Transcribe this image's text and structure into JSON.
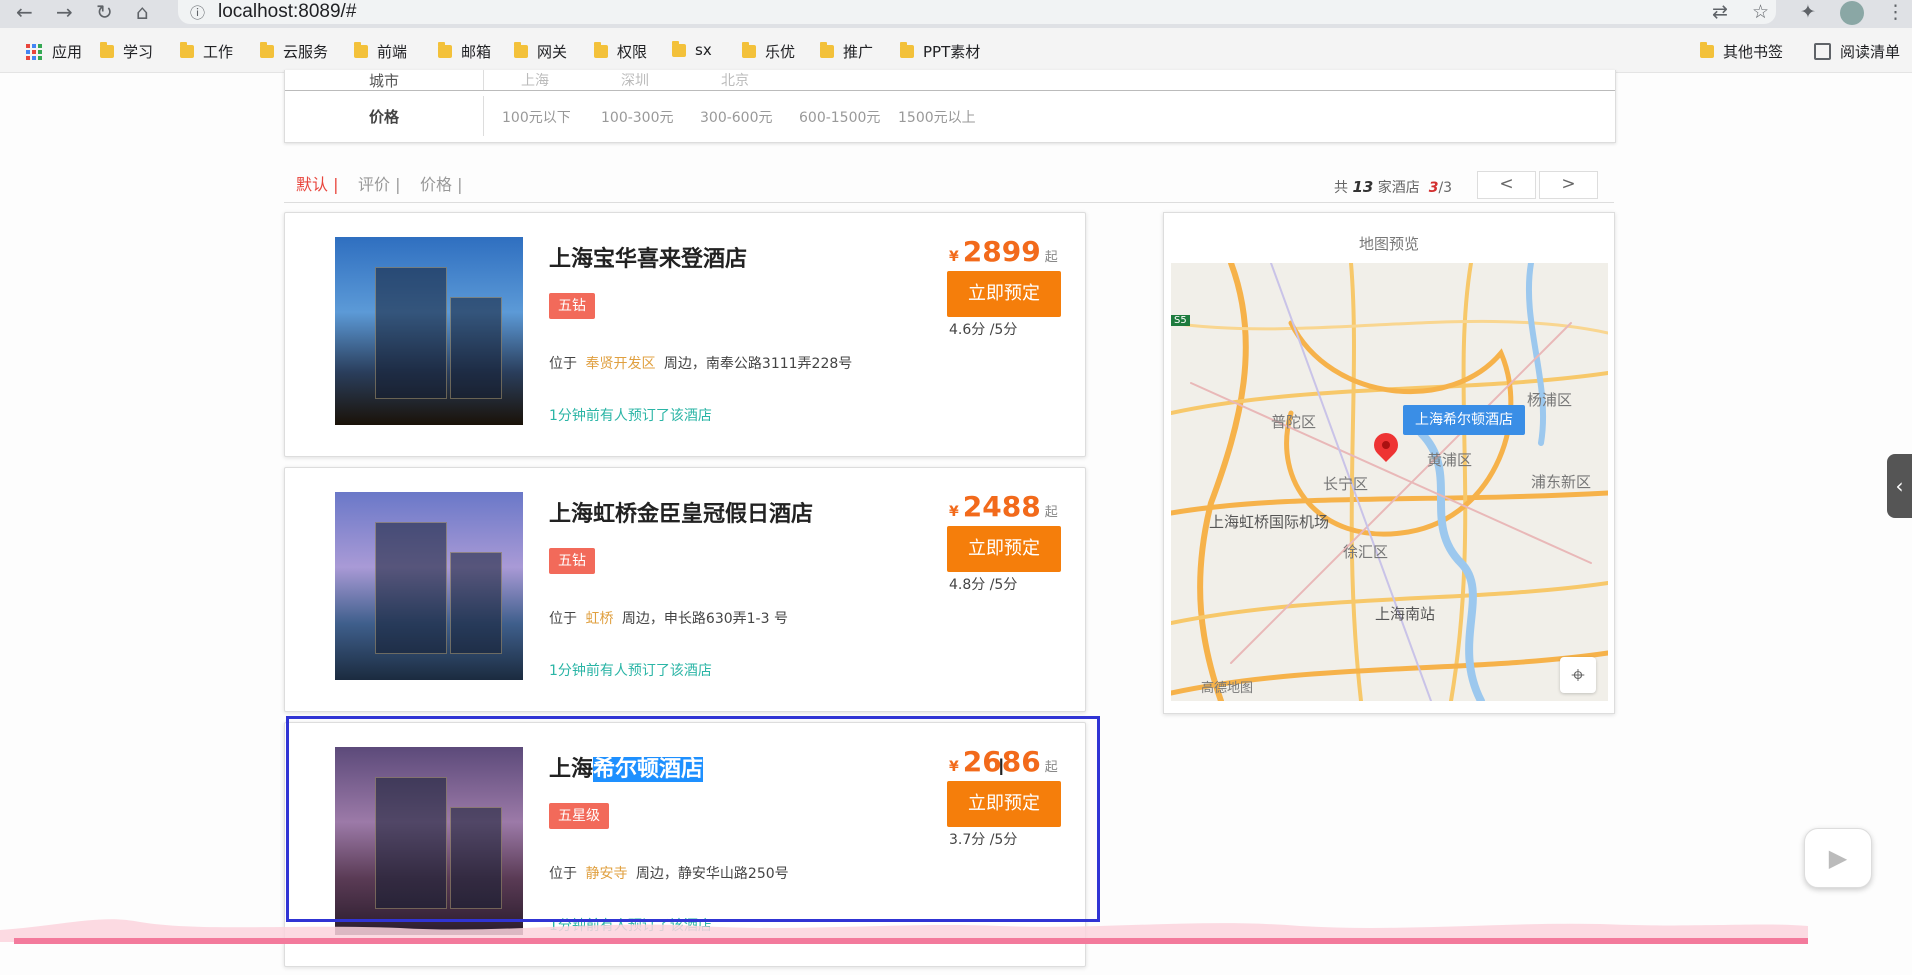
{
  "browser": {
    "url": "localhost:8089/#",
    "bookmarks": [
      {
        "label": "应用",
        "type": "apps"
      },
      {
        "label": "学习",
        "type": "folder"
      },
      {
        "label": "工作",
        "type": "folder"
      },
      {
        "label": "云服务",
        "type": "folder"
      },
      {
        "label": "前端",
        "type": "folder"
      },
      {
        "label": "邮箱",
        "type": "folder"
      },
      {
        "label": "网关",
        "type": "folder"
      },
      {
        "label": "权限",
        "type": "folder"
      },
      {
        "label": "sx",
        "type": "folder"
      },
      {
        "label": "乐优",
        "type": "folder"
      },
      {
        "label": "推广",
        "type": "folder"
      },
      {
        "label": "PPT素材",
        "type": "folder"
      }
    ],
    "other_bookmarks": "其他书签",
    "reading_list": "阅读清单"
  },
  "filter": {
    "city_label": "城市",
    "cities": [
      "上海",
      "深圳",
      "北京"
    ],
    "price_label": "价格",
    "prices": [
      "100元以下",
      "100-300元",
      "300-600元",
      "600-1500元",
      "1500元以上"
    ]
  },
  "sort": {
    "options": [
      "默认 |",
      "评价 |",
      "价格 |"
    ],
    "active_index": 0,
    "total_prefix": "共",
    "total": "13",
    "total_suffix": "家酒店",
    "page_current": "3",
    "page_total": "/3",
    "prev": "<",
    "next": ">"
  },
  "hotels": [
    {
      "name": "上海宝华喜来登酒店",
      "name_plain": "",
      "name_highlight": "",
      "tag": "五钻",
      "addr_prefix": "位于",
      "area": "奉贤开发区",
      "addr_suffix": "周边，南奉公路3111弄228号",
      "booked": "1分钟前有人预订了该酒店",
      "yen": "¥",
      "price": "2899",
      "qi": "起",
      "book": "立即预定",
      "score": "4.6分 /5分"
    },
    {
      "name": "上海虹桥金臣皇冠假日酒店",
      "name_plain": "",
      "name_highlight": "",
      "tag": "五钻",
      "addr_prefix": "位于",
      "area": "虹桥",
      "addr_suffix": "周边，申长路630弄1-3 号",
      "booked": "1分钟前有人预订了该酒店",
      "yen": "¥",
      "price": "2488",
      "qi": "起",
      "book": "立即预定",
      "score": "4.8分 /5分"
    },
    {
      "name": "",
      "name_plain": "上海",
      "name_highlight": "希尔顿酒店",
      "tag": "五星级",
      "addr_prefix": "位于",
      "area": "静安寺",
      "addr_suffix": "周边，静安华山路250号",
      "booked": "1分钟前有人预订了该酒店",
      "yen": "¥",
      "price": "2686",
      "qi": "起",
      "book": "立即预定",
      "score": "3.7分 /5分"
    }
  ],
  "map": {
    "title": "地图预览",
    "marker_label": "上海希尔顿酒店",
    "labels": [
      {
        "text": "普陀区"
      },
      {
        "text": "杨浦区"
      },
      {
        "text": "黄浦区"
      },
      {
        "text": "长宁区"
      },
      {
        "text": "浦东新区"
      },
      {
        "text": "上海虹桥国际机场"
      },
      {
        "text": "徐汇区"
      },
      {
        "text": "上海南站"
      },
      {
        "text": "高德地图"
      },
      {
        "text": "S5"
      }
    ]
  }
}
